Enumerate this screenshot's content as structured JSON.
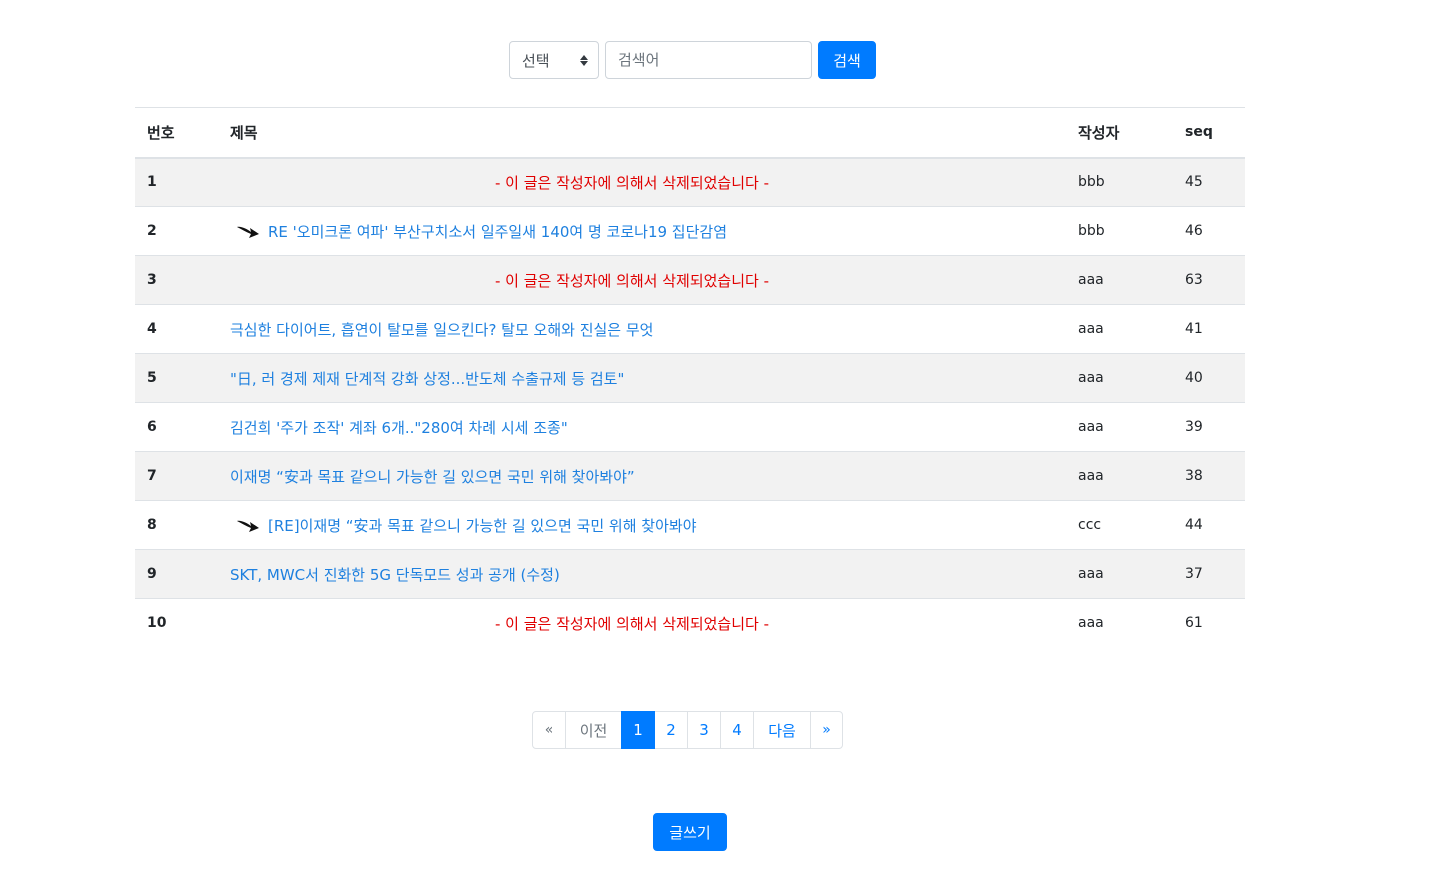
{
  "search": {
    "select_value": "선택",
    "placeholder": "검색어",
    "button_label": "검색"
  },
  "table": {
    "headers": {
      "num": "번호",
      "title": "제목",
      "writer": "작성자",
      "seq": "seq"
    },
    "rows": [
      {
        "num": "1",
        "title": "- 이 글은 작성자에 의해서 삭제되었습니다 -",
        "writer": "bbb",
        "seq": "45"
      },
      {
        "num": "2",
        "title": "RE '오미크론 여파' 부산구치소서 일주일새 140여 명 코로나19 집단감염",
        "writer": "bbb",
        "seq": "46"
      },
      {
        "num": "3",
        "title": "- 이 글은 작성자에 의해서 삭제되었습니다 -",
        "writer": "aaa",
        "seq": "63"
      },
      {
        "num": "4",
        "title": "극심한 다이어트, 흡연이 탈모를 일으킨다? 탈모 오해와 진실은 무엇",
        "writer": "aaa",
        "seq": "41"
      },
      {
        "num": "5",
        "title": "\"日, 러 경제 제재 단계적 강화 상정...반도체 수출규제 등 검토\"",
        "writer": "aaa",
        "seq": "40"
      },
      {
        "num": "6",
        "title": "김건희 '주가 조작' 계좌 6개..\"280여 차례 시세 조종\"",
        "writer": "aaa",
        "seq": "39"
      },
      {
        "num": "7",
        "title": "이재명 “安과 목표 같으니 가능한 길 있으면 국민 위해 찾아봐야”",
        "writer": "aaa",
        "seq": "38"
      },
      {
        "num": "8",
        "title": "[RE]이재명 “安과 목표 같으니 가능한 길 있으면 국민 위해 찾아봐야",
        "writer": "ccc",
        "seq": "44"
      },
      {
        "num": "9",
        "title": "SKT, MWC서 진화한 5G 단독모드 성과 공개 (수정)",
        "writer": "aaa",
        "seq": "37"
      },
      {
        "num": "10",
        "title": "- 이 글은 작성자에 의해서 삭제되었습니다 -",
        "writer": "aaa",
        "seq": "61"
      }
    ]
  },
  "pagination": {
    "first": "«",
    "prev": "이전",
    "pages": [
      "1",
      "2",
      "3",
      "4"
    ],
    "active_page": "1",
    "next": "다음",
    "last": "»"
  },
  "write_button_label": "글쓰기",
  "colors": {
    "primary": "#007bff",
    "link": "#1e80df",
    "deleted": "#e00000",
    "stripe": "#f2f2f2"
  }
}
